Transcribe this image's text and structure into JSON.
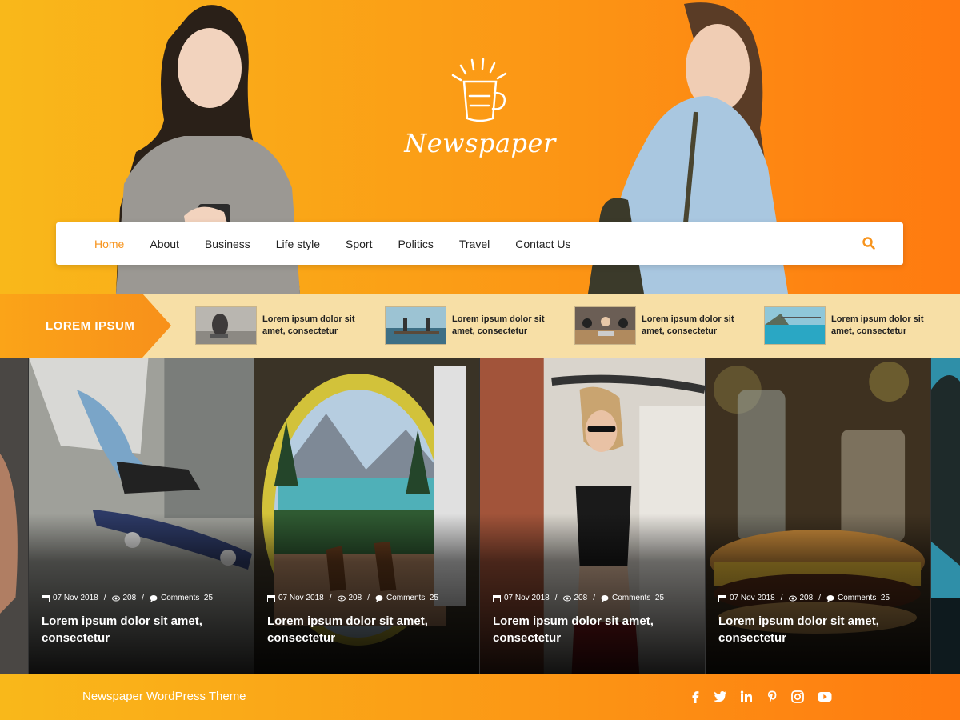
{
  "site": {
    "logo_text": "Newspaper"
  },
  "nav": {
    "items": [
      "Home",
      "About",
      "Business",
      "Life style",
      "Sport",
      "Politics",
      "Travel",
      "Contact Us"
    ],
    "active": "Home",
    "search_icon": "search-icon"
  },
  "ticker": {
    "label": "LOREM IPSUM",
    "items": [
      {
        "title": "Lorem ipsum dolor sit amet, consectetur"
      },
      {
        "title": "Lorem ipsum dolor sit amet, consectetur"
      },
      {
        "title": "Lorem ipsum dolor sit amet, consectetur"
      },
      {
        "title": "Lorem ipsum dolor sit amet, consectetur"
      }
    ]
  },
  "slides": [
    {
      "date": "07 Nov 2018",
      "views": "208",
      "comments_label": "Comments",
      "comments": "25",
      "title": "Lorem ipsum dolor sit amet, consectetur"
    },
    {
      "date": "07 Nov 2018",
      "views": "208",
      "comments_label": "Comments",
      "comments": "25",
      "title": "Lorem ipsum dolor sit amet, consectetur"
    },
    {
      "date": "07 Nov 2018",
      "views": "208",
      "comments_label": "Comments",
      "comments": "25",
      "title": "Lorem ipsum dolor sit amet, consectetur"
    },
    {
      "date": "07 Nov 2018",
      "views": "208",
      "comments_label": "Comments",
      "comments": "25",
      "title": "Lorem ipsum dolor sit amet, consectetur"
    }
  ],
  "footer": {
    "text": "Newspaper WordPress Theme",
    "social_icons": [
      "facebook-icon",
      "twitter-icon",
      "linkedin-icon",
      "pinterest-icon",
      "instagram-icon",
      "youtube-icon"
    ]
  },
  "colors": {
    "accent": "#f7941d",
    "header_gradient": [
      "#f9b81a",
      "#ff7a10"
    ],
    "ticker_bg": "#f7dfa6"
  }
}
